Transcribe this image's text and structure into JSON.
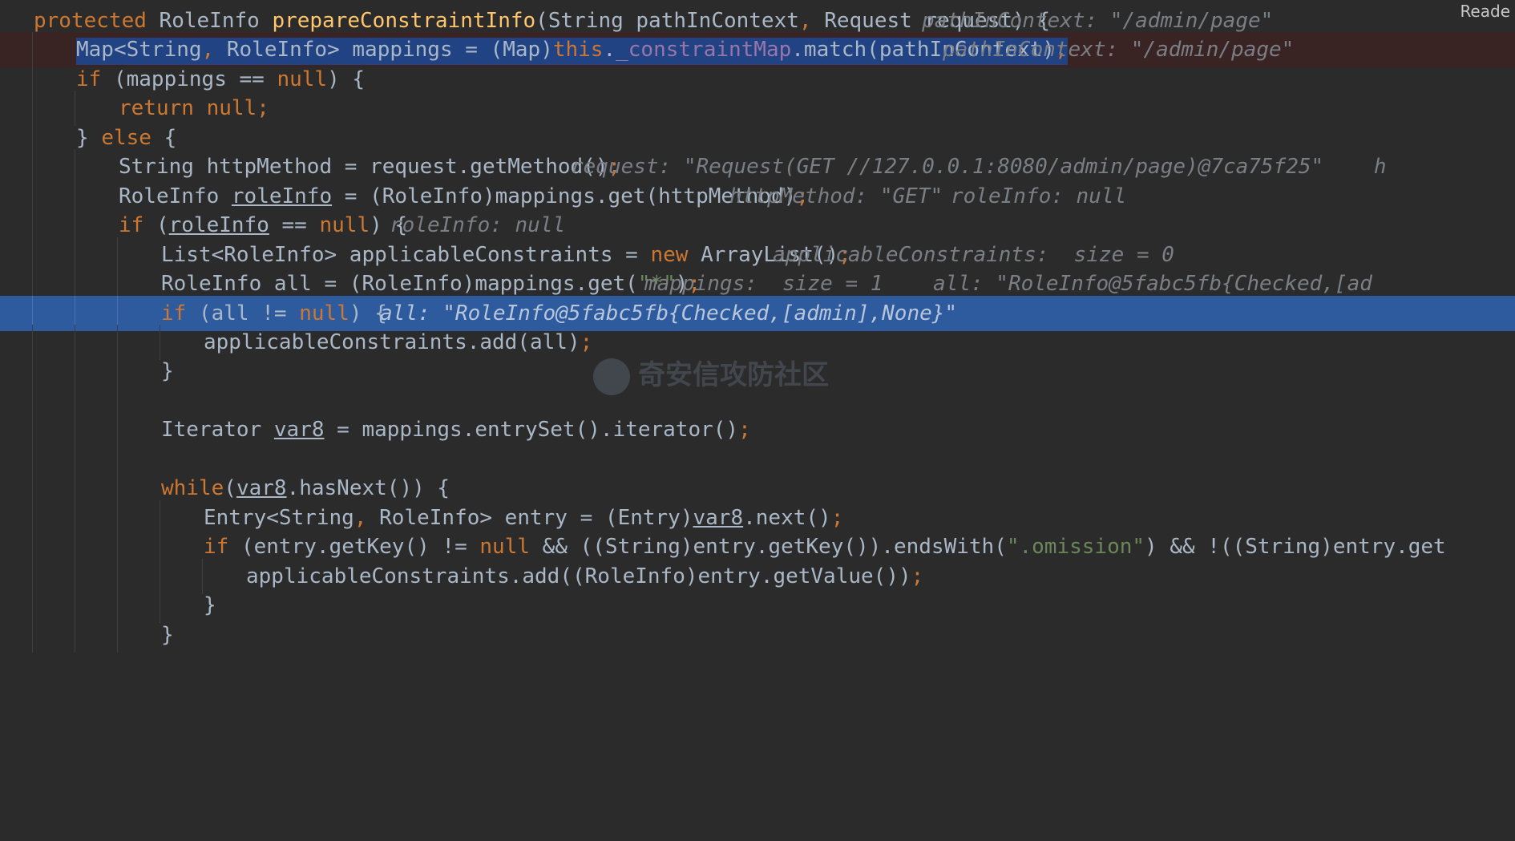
{
  "reader_mode_label": "Reade",
  "watermark_text": "奇安信攻防社区",
  "inlay_hints": {
    "l0": "pathInContext: \"/admin/page\"",
    "l1": "pathInContext: \"/admin/page\"",
    "l5": "request: \"Request(GET //127.0.0.1:8080/admin/page)@7ca75f25\"    h",
    "l6a": "httpMethod: \"GET\"",
    "l6b": "roleInfo: null",
    "l7": "roleInfo: null",
    "l8": "applicableConstraints:  size = 0",
    "l9": "mappings:  size = 1    all: \"RoleInfo@5fabc5fb{Checked,[ad",
    "l10": "all: \"RoleInfo@5fabc5fb{Checked,[admin],None}\""
  },
  "code": {
    "protected": "protected",
    "ret_type": "RoleInfo ",
    "method_name": "prepareConstraintInfo",
    "params_1": "(String pathInContext",
    "comma": ",",
    "params_2": " Request request) {",
    "l1_a": "Map<String",
    "l1_b": " RoleInfo> mappings = (Map)",
    "this": "this",
    "dot": ".",
    "constraint_map": "_constraintMap",
    "l1_c": ".match(pathInContext)",
    "semi": ";",
    "if": "if",
    "l2_a": " (mappings == ",
    "null": "null",
    "l2_b": ") {",
    "return": "return",
    "space": " ",
    "close_brace": "}",
    "else": "else",
    "open_brace": "{",
    "l5_a": "String httpMethod = request.getMethod()",
    "l6_a": "RoleInfo ",
    "role_info": "roleInfo",
    "l6_b": " = (RoleInfo)mappings.get(httpMethod)",
    "l7_a": " (",
    "l7_b": " == ",
    "l7_c": ") {",
    "l8_a": "List<RoleInfo> applicableConstraints = ",
    "new": "new",
    "l8_b": " ArrayList()",
    "l9_a": "RoleInfo all = (RoleInfo)mappings.get(",
    "star_str": "\"*\"",
    "l9_b": ")",
    "l10_a": " (all != ",
    "l10_b": ") {",
    "l11_a": "applicableConstraints.add(all)",
    "l14_a": "Iterator ",
    "var8": "var8",
    "l14_b": " = mappings.entrySet().iterator()",
    "while": "while",
    "paren_open": "(",
    "l16_b": ".hasNext()) {",
    "l17_a": "Entry<String",
    "l17_b": " RoleInfo> entry = (Entry)",
    "l17_c": ".next()",
    "l18_a": " (entry.getKey() != ",
    "l18_b": " && ((String)entry.getKey()).endsWith(",
    "omission_str": "\".omission\"",
    "l18_c": ") && !((String)entry.get",
    "l19_a": "applicableConstraints.add((RoleInfo)entry.getValue())"
  }
}
